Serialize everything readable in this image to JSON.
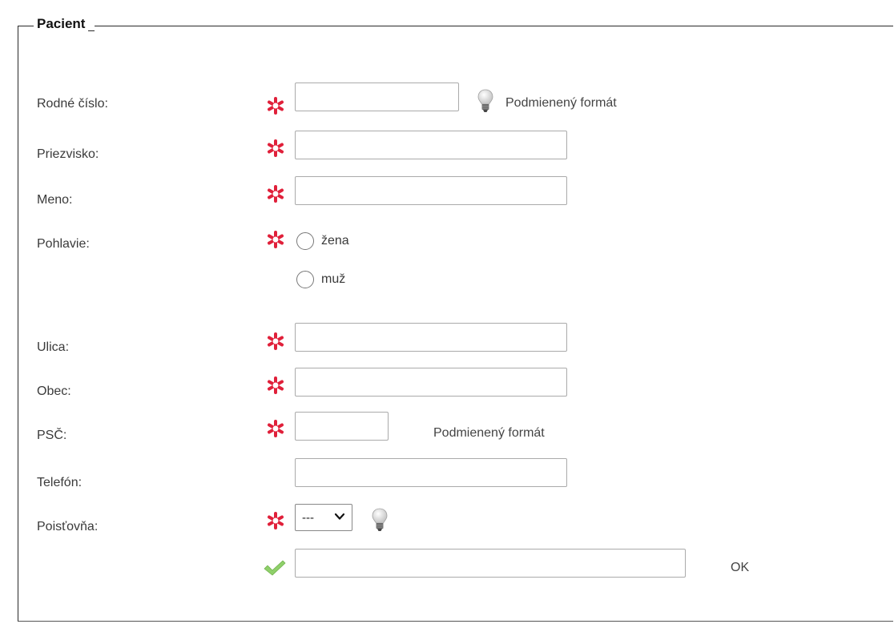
{
  "fieldset": {
    "legend": "Pacient"
  },
  "fields": {
    "rodne_cislo": {
      "label": "Rodné číslo:",
      "value": "",
      "hint": "Podmienený formát"
    },
    "priezvisko": {
      "label": "Priezvisko:",
      "value": ""
    },
    "meno": {
      "label": "Meno:",
      "value": ""
    },
    "pohlavie": {
      "label": "Pohlavie:",
      "options": [
        {
          "label": "žena",
          "checked": false
        },
        {
          "label": "muž",
          "checked": false
        }
      ]
    },
    "ulica": {
      "label": "Ulica:",
      "value": ""
    },
    "obec": {
      "label": "Obec:",
      "value": ""
    },
    "psc": {
      "label": "PSČ:",
      "value": "",
      "hint": "Podmienený formát"
    },
    "telefon": {
      "label": "Telefón:",
      "value": ""
    },
    "poistovna": {
      "label": "Poisťovňa:",
      "selected": "---"
    },
    "extra": {
      "value": "",
      "status": "OK"
    }
  },
  "icons": {
    "required": "asterisk-icon",
    "hint": "lightbulb-icon",
    "valid": "checkmark-icon",
    "dropdown": "chevron-down-icon"
  },
  "colors": {
    "required": "#e0203a",
    "valid": "#8fd06a",
    "border": "#aaaaaa"
  }
}
